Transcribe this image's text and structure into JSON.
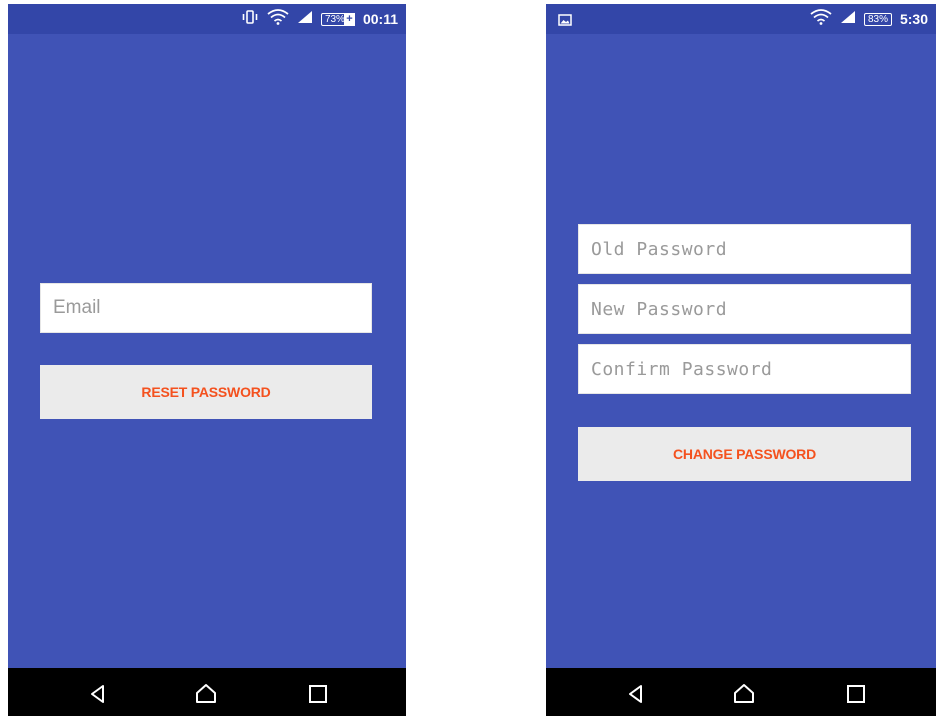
{
  "left_screen": {
    "status_bar": {
      "icons": [
        "vibrate-icon",
        "wifi-icon",
        "signal-icon",
        "battery-charging-icon"
      ],
      "battery": "73%",
      "time": "00:11"
    },
    "email": {
      "placeholder": "Email",
      "value": ""
    },
    "reset_button": "RESET PASSWORD",
    "nav": [
      "back-icon",
      "home-icon",
      "recents-icon"
    ]
  },
  "right_screen": {
    "status_bar": {
      "icons": [
        "gallery-icon",
        "wifi-icon",
        "signal-icon",
        "battery-icon"
      ],
      "battery": "83%",
      "time": "5:30"
    },
    "old_password": {
      "placeholder": "Old Password",
      "value": ""
    },
    "new_password": {
      "placeholder": "New Password",
      "value": ""
    },
    "confirm_password": {
      "placeholder": "Confirm Password",
      "value": ""
    },
    "change_button": "CHANGE PASSWORD",
    "nav": [
      "back-icon",
      "home-icon",
      "recents-icon"
    ]
  },
  "colors": {
    "status_bar": "#3346a8",
    "background": "#4053b6",
    "nav_bar": "#000000",
    "button_bg": "#ebebeb",
    "button_text": "#f4511e"
  }
}
